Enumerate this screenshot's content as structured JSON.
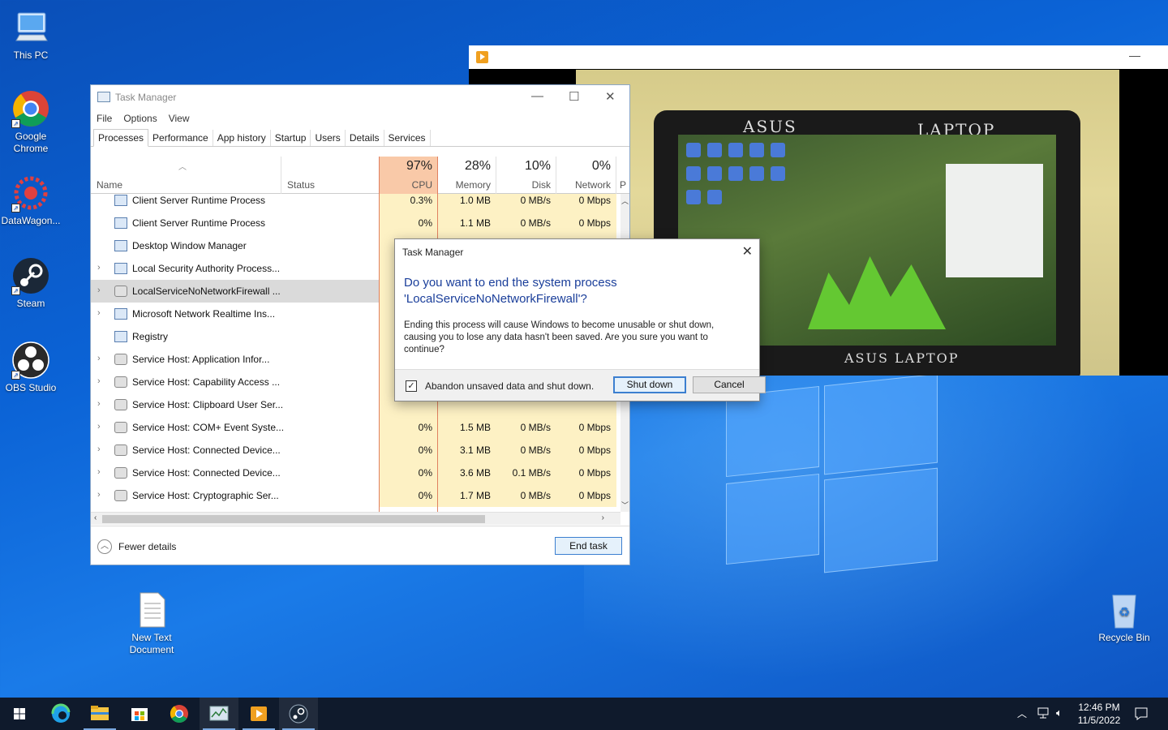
{
  "desktop": {
    "icons": [
      {
        "label": "This PC"
      },
      {
        "label": "Google Chrome"
      },
      {
        "label": "DataWagon..."
      },
      {
        "label": "Steam"
      },
      {
        "label": "OBS Studio"
      },
      {
        "label": "New Text Document"
      },
      {
        "label": "Recycle Bin"
      }
    ]
  },
  "task_manager": {
    "title": "Task Manager",
    "menu": [
      "File",
      "Options",
      "View"
    ],
    "tabs": [
      "Processes",
      "Performance",
      "App history",
      "Startup",
      "Users",
      "Details",
      "Services"
    ],
    "active_tab": "Processes",
    "columns": {
      "name": "Name",
      "status": "Status",
      "cpu_pct": "97%",
      "cpu": "CPU",
      "mem_pct": "28%",
      "mem": "Memory",
      "disk_pct": "10%",
      "disk": "Disk",
      "net_pct": "0%",
      "net": "Network",
      "power": "P"
    },
    "rows": [
      {
        "name": "Client Server Runtime Process",
        "cpu": "0.3%",
        "mem": "1.0 MB",
        "disk": "0 MB/s",
        "net": "0 Mbps",
        "expand": false,
        "type": "app"
      },
      {
        "name": "Client Server Runtime Process",
        "cpu": "0%",
        "mem": "1.1 MB",
        "disk": "0 MB/s",
        "net": "0 Mbps",
        "expand": false,
        "type": "app"
      },
      {
        "name": "Desktop Window Manager",
        "cpu": "",
        "mem": "",
        "disk": "",
        "net": "",
        "expand": false,
        "type": "app"
      },
      {
        "name": "Local Security Authority Process...",
        "cpu": "",
        "mem": "",
        "disk": "",
        "net": "",
        "expand": true,
        "type": "app"
      },
      {
        "name": "LocalServiceNoNetworkFirewall ...",
        "cpu": "",
        "mem": "",
        "disk": "",
        "net": "",
        "expand": true,
        "type": "svc",
        "selected": true
      },
      {
        "name": "Microsoft Network Realtime Ins...",
        "cpu": "",
        "mem": "",
        "disk": "",
        "net": "",
        "expand": true,
        "type": "app"
      },
      {
        "name": "Registry",
        "cpu": "",
        "mem": "",
        "disk": "",
        "net": "",
        "expand": false,
        "type": "app"
      },
      {
        "name": "Service Host: Application Infor...",
        "cpu": "",
        "mem": "",
        "disk": "",
        "net": "",
        "expand": true,
        "type": "svc"
      },
      {
        "name": "Service Host: Capability Access ...",
        "cpu": "",
        "mem": "",
        "disk": "",
        "net": "",
        "expand": true,
        "type": "svc"
      },
      {
        "name": "Service Host: Clipboard User Ser...",
        "cpu": "",
        "mem": "",
        "disk": "",
        "net": "",
        "expand": true,
        "type": "svc"
      },
      {
        "name": "Service Host: COM+ Event Syste...",
        "cpu": "0%",
        "mem": "1.5 MB",
        "disk": "0 MB/s",
        "net": "0 Mbps",
        "expand": true,
        "type": "svc"
      },
      {
        "name": "Service Host: Connected Device...",
        "cpu": "0%",
        "mem": "3.1 MB",
        "disk": "0 MB/s",
        "net": "0 Mbps",
        "expand": true,
        "type": "svc"
      },
      {
        "name": "Service Host: Connected Device...",
        "cpu": "0%",
        "mem": "3.6 MB",
        "disk": "0.1 MB/s",
        "net": "0 Mbps",
        "expand": true,
        "type": "svc"
      },
      {
        "name": "Service Host: Cryptographic Ser...",
        "cpu": "0%",
        "mem": "1.7 MB",
        "disk": "0 MB/s",
        "net": "0 Mbps",
        "expand": true,
        "type": "svc"
      }
    ],
    "fewer_details": "Fewer details",
    "end_task": "End task"
  },
  "dialog": {
    "title": "Task Manager",
    "main_line1": "Do you want to end the system process",
    "main_line2": "'LocalServiceNoNetworkFirewall'?",
    "body": "Ending this process will cause Windows to become unusable or shut down, causing you to lose any data hasn't been saved. Are you sure you want to continue?",
    "checkbox_label": "Abandon unsaved data and shut down.",
    "checkbox_checked": true,
    "shutdown_label": "Shut down",
    "cancel_label": "Cancel"
  },
  "video_window": {
    "laptop_brand_top": "ASUS",
    "laptop_label_top": "LAPTOP",
    "laptop_label_bottom": "ASUS LAPTOP"
  },
  "taskbar": {
    "apps": [
      "start-icon",
      "edge-icon",
      "file-explorer-icon",
      "store-icon",
      "chrome-icon",
      "task-manager-icon",
      "media-player-icon",
      "steam-icon"
    ],
    "time": "12:46 PM",
    "date": "11/5/2022"
  }
}
